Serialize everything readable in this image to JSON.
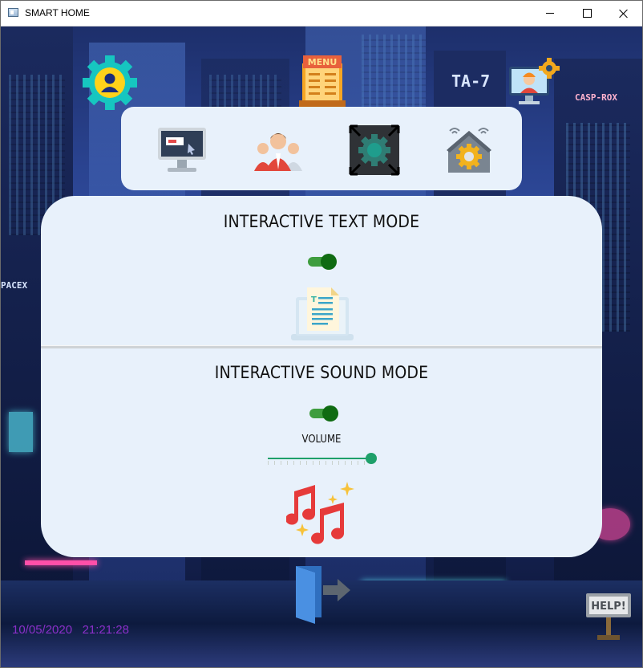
{
  "window": {
    "title": "SMART HOME",
    "controls": {
      "minimize": "minimize",
      "maximize": "maximize",
      "close": "close"
    }
  },
  "background": {
    "signs": [
      "TA-7",
      "CASP-ROX",
      "PACEX"
    ]
  },
  "top_bar": {
    "icons": [
      "user-settings-icon",
      "menu-icon",
      "engineer-settings-icon"
    ],
    "menu_label": "MENU"
  },
  "nav": {
    "icons": [
      "monitor-icon",
      "users-icon",
      "fullscreen-settings-icon",
      "smart-home-icon"
    ]
  },
  "text_mode": {
    "title": "INTERACTIVE TEXT MODE",
    "toggle_on": true,
    "icon": "document-icon"
  },
  "sound_mode": {
    "title": "INTERACTIVE SOUND MODE",
    "toggle_on": true,
    "volume_label": "VOLUME",
    "volume_level": 1.0,
    "icon": "music-notes-icon"
  },
  "footer": {
    "exit_icon": "exit-door-icon",
    "help_label": "HELP!",
    "datetime": "10/05/2020   21:21:28"
  },
  "colors": {
    "card_bg": "#e8f1fb",
    "toggle_on": "#0f6b12",
    "slider": "#1ea06a",
    "datetime": "#8b2fc9"
  }
}
